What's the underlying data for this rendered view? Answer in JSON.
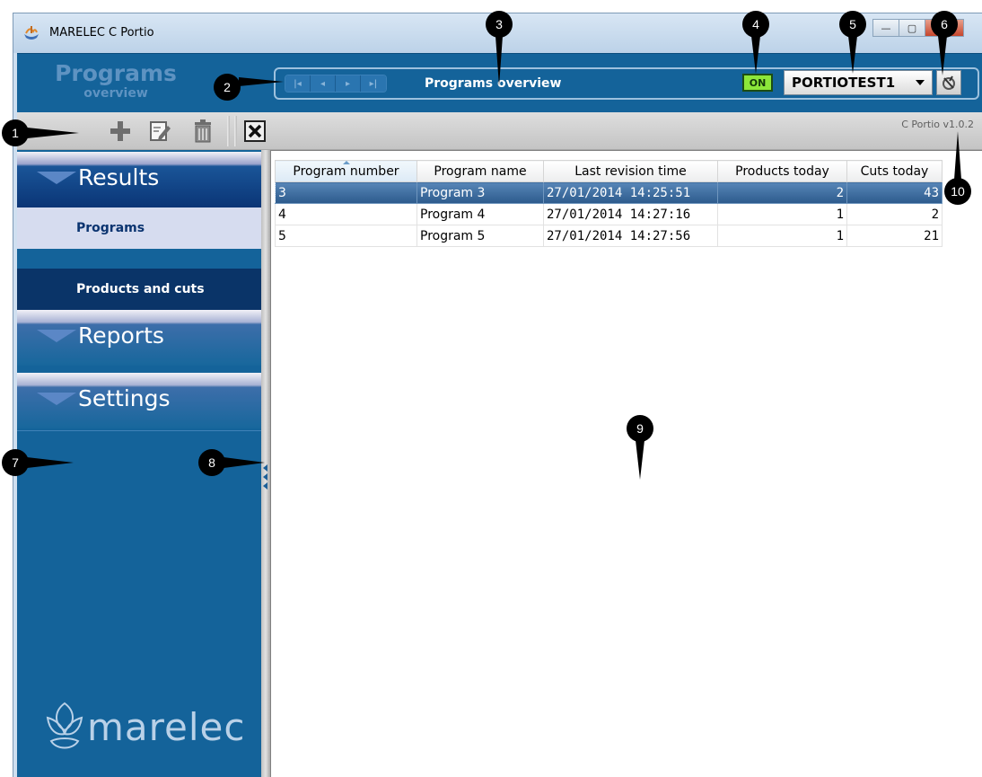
{
  "window": {
    "title": "MARELEC C Portio"
  },
  "header": {
    "title": "Programs",
    "subtitle": "overview",
    "label": "Programs overview",
    "status": "ON",
    "machine": "PORTIOTEST1",
    "nav_icons": [
      "first-icon",
      "prev-icon",
      "next-icon",
      "last-icon"
    ]
  },
  "toolbar": {
    "version": "C Portio v1.0.2",
    "icons": [
      "add-icon",
      "edit-icon",
      "delete-icon",
      "export-excel-icon"
    ]
  },
  "sidebar": {
    "sections": [
      {
        "label": "Results",
        "items": [
          {
            "label": "Programs",
            "active": true
          },
          {
            "label": "Products and cuts",
            "active": false
          }
        ]
      },
      {
        "label": "Reports",
        "items": []
      },
      {
        "label": "Settings",
        "items": []
      }
    ],
    "logo": "marelec"
  },
  "table": {
    "columns": [
      "Program number",
      "Program name",
      "Last revision time",
      "Products today",
      "Cuts today"
    ],
    "rows": [
      [
        "3",
        "Program 3",
        "27/01/2014 14:25:51",
        "2",
        "43"
      ],
      [
        "4",
        "Program 4",
        "27/01/2014 14:27:16",
        "1",
        "2"
      ],
      [
        "5",
        "Program 5",
        "27/01/2014 14:27:56",
        "1",
        "21"
      ]
    ],
    "selected_row": 0
  },
  "callouts": [
    "1",
    "2",
    "3",
    "4",
    "5",
    "6",
    "7",
    "8",
    "9",
    "10"
  ],
  "colors": {
    "header_blue": "#14639a",
    "sidebar_navy": "#0a3468",
    "status_green": "#8ce63a"
  }
}
